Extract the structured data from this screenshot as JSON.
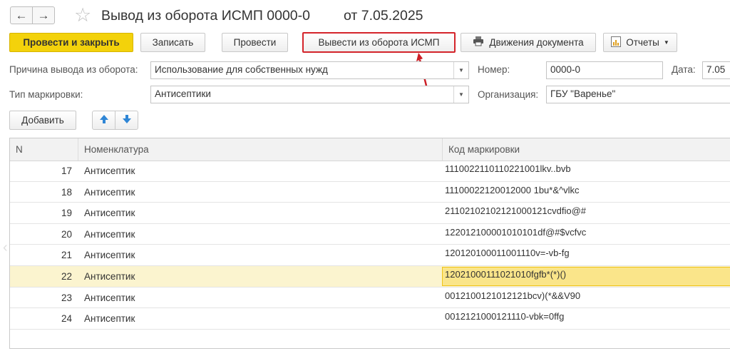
{
  "header": {
    "back_icon": "←",
    "forward_icon": "→",
    "favorite_icon": "☆",
    "title": "Вывод из оборота ИСМП 0000-0",
    "date_text": "от   7.05.2025"
  },
  "toolbar": {
    "post_close": "Провести и закрыть",
    "save": "Записать",
    "post": "Провести",
    "withdraw": "Вывести из оборота ИСМП",
    "movements": "Движения документа",
    "reports": "Отчеты"
  },
  "form": {
    "reason_label": "Причина вывода из оборота:",
    "reason_value": "Использование для собственных нужд",
    "number_label": "Номер:",
    "number_value": "0000-0",
    "date_label": "Дата:",
    "date_value": "7.05",
    "marking_label": "Тип маркировки:",
    "marking_value": "Антисептики",
    "org_label": "Организация:",
    "org_value": "ГБУ \"Варенье\""
  },
  "table_toolbar": {
    "add": "Добавить",
    "up_icon": "▲",
    "down_icon": "▼"
  },
  "table": {
    "columns": [
      "N",
      "Номенклатура",
      "Код маркировки"
    ],
    "rows": [
      {
        "n": "17",
        "nom": "Антисептик",
        "code": "1110022110110221001lkv..bvb"
      },
      {
        "n": "18",
        "nom": "Антисептик",
        "code": "11100022120012000 1bu*&^vlkc"
      },
      {
        "n": "19",
        "nom": "Антисептик",
        "code": "21102102102121000121cvdfio@#"
      },
      {
        "n": "20",
        "nom": "Антисептик",
        "code": "122012100001010101df@#$vcfvc"
      },
      {
        "n": "21",
        "nom": "Антисептик",
        "code": "120120100011001110v=-vb-fg"
      },
      {
        "n": "22",
        "nom": "Антисептик",
        "code": "12021000111021010fgfb*(*)()"
      },
      {
        "n": "23",
        "nom": "Антисептик",
        "code": "0012100121012121bcv)(*&&V90"
      },
      {
        "n": "24",
        "nom": "Антисептик",
        "code": "0012121000121110-vbk=0ffg"
      }
    ],
    "selected_row": "22"
  },
  "colors": {
    "primary_button": "#f3d20b",
    "highlight_border": "#d4242a",
    "selected_row": "#fbf4cf",
    "selected_cell": "#fae58a"
  }
}
